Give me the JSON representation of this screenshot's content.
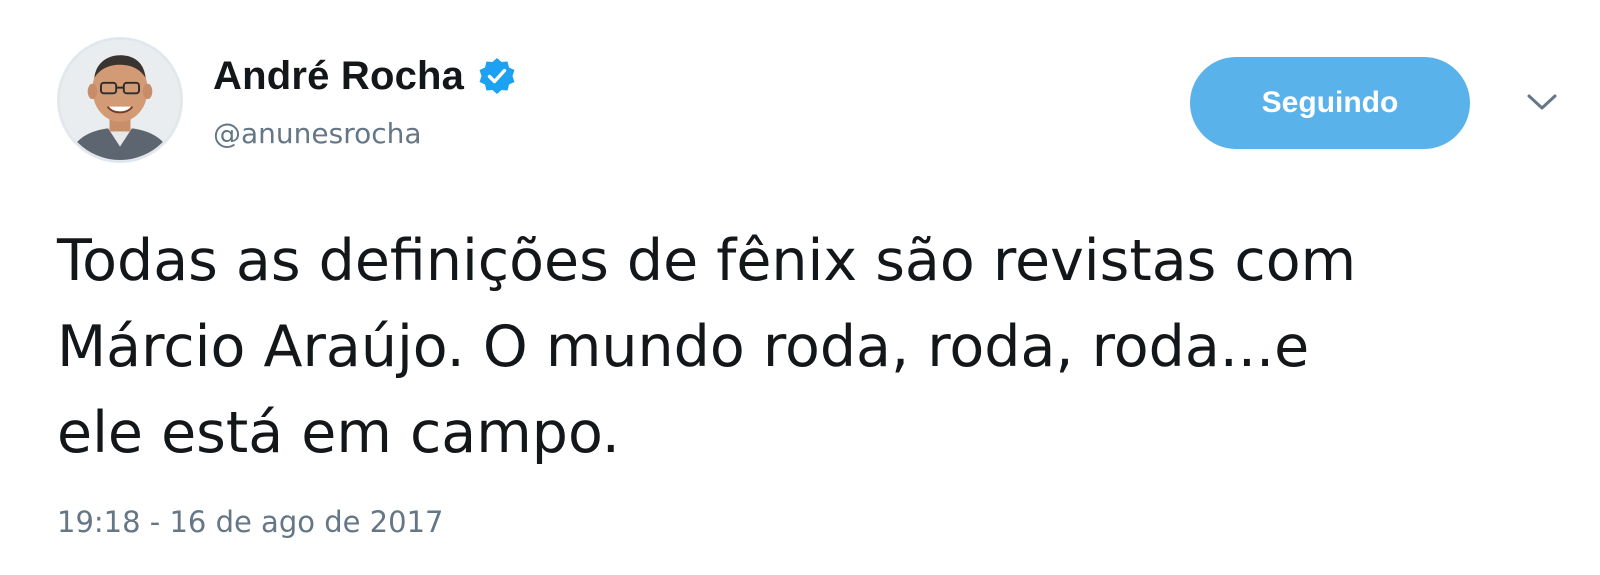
{
  "user": {
    "display_name": "André Rocha",
    "handle": "@anunesrocha",
    "verified_icon": "verified-badge-icon",
    "avatar_icon": "user-avatar"
  },
  "actions": {
    "follow_label": "Seguindo",
    "menu_icon": "chevron-down-icon"
  },
  "tweet": {
    "text": "Todas as definições de fênix são revistas com\nMárcio Araújo. O mundo roda, roda, roda...e\nele está em campo.",
    "timestamp": "19:18 - 16 de ago de 2017"
  },
  "colors": {
    "accent": "#1da1f2",
    "follow_button": "#5ab2eb",
    "text": "#14171a",
    "secondary_text": "#657786"
  }
}
